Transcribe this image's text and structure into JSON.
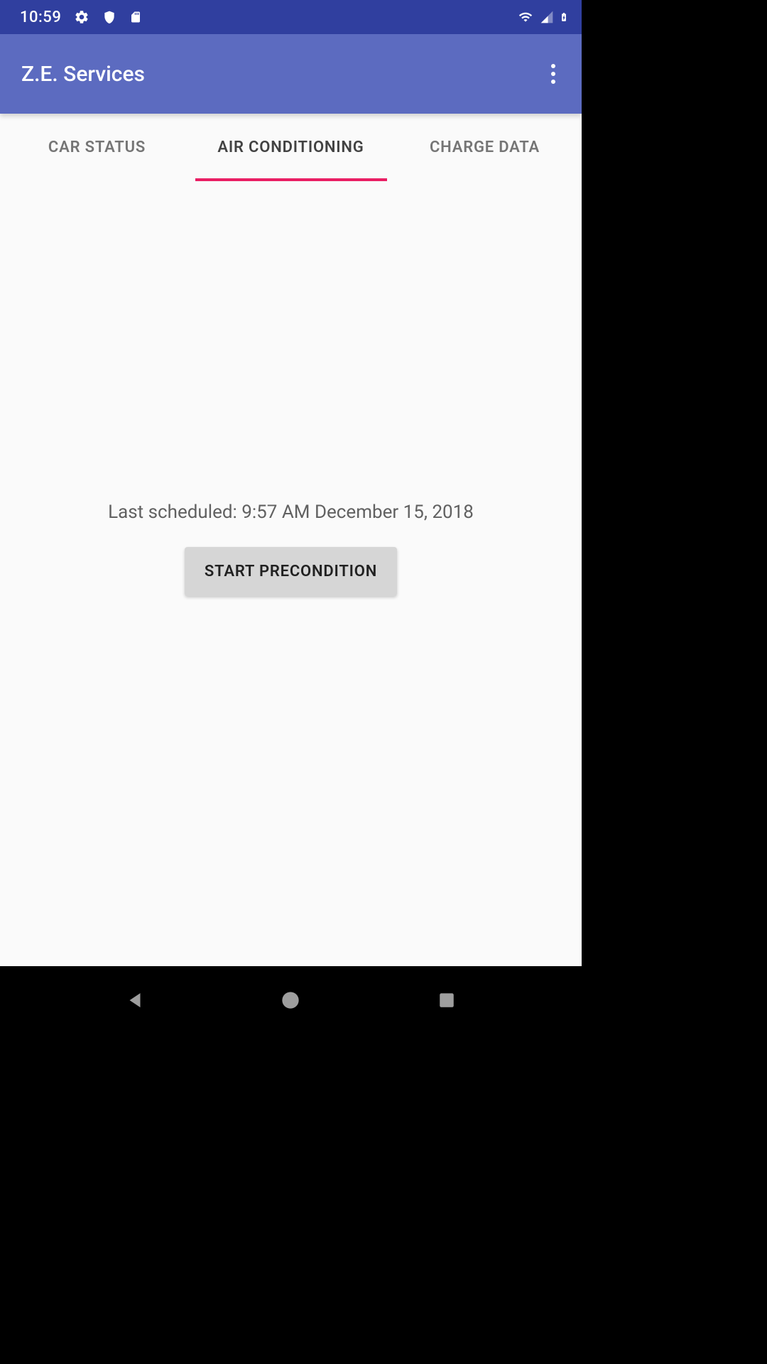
{
  "status_bar": {
    "time": "10:59"
  },
  "app_bar": {
    "title": "Z.E. Services"
  },
  "tabs": {
    "items": [
      {
        "label": "CAR STATUS",
        "active": false
      },
      {
        "label": "AIR CONDITIONING",
        "active": true
      },
      {
        "label": "CHARGE DATA",
        "active": false
      }
    ]
  },
  "content": {
    "last_scheduled": "Last scheduled: 9:57 AM December 15, 2018",
    "button_label": "START PRECONDITION"
  },
  "colors": {
    "status_bar_bg": "#303F9F",
    "app_bar_bg": "#5C6BC0",
    "tab_indicator": "#E91E63",
    "body_bg": "#fafafa"
  }
}
